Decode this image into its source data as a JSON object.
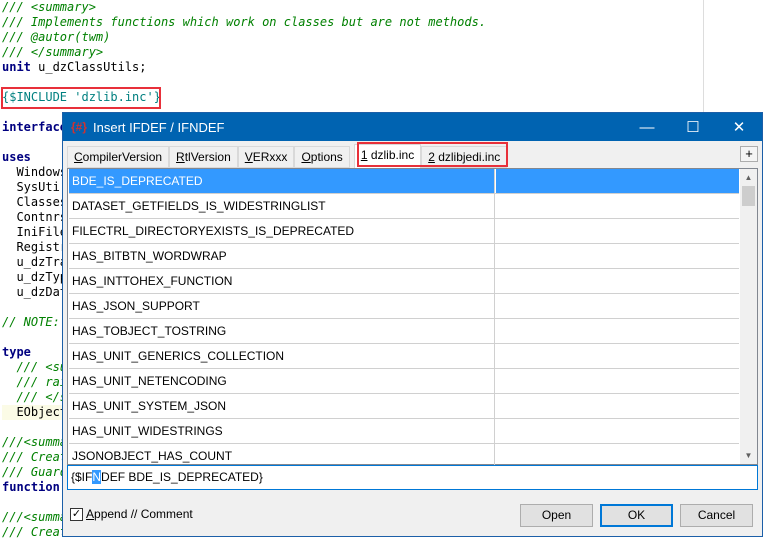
{
  "editor": {
    "lines": [
      {
        "t": "/// <summary>",
        "c": "cm"
      },
      {
        "t": "/// Implements functions which work on classes but are not methods.",
        "c": "cm"
      },
      {
        "t": "/// @autor(twm)",
        "c": "cm"
      },
      {
        "t": "/// </summary>",
        "c": "cm"
      },
      {
        "t": "unit",
        "c": "kw",
        "rest": " u_dzClassUtils;"
      },
      {
        "t": "",
        "c": "pl"
      },
      {
        "t": "{$INCLUDE 'dzlib.inc'}",
        "c": "dir"
      },
      {
        "t": "",
        "c": "pl"
      },
      {
        "t": "interface",
        "c": "kw"
      },
      {
        "t": "",
        "c": "pl"
      },
      {
        "t": "uses",
        "c": "kw"
      },
      {
        "t": "  Windows",
        "c": "pl"
      },
      {
        "t": "  SysUti",
        "c": "pl"
      },
      {
        "t": "  Classes",
        "c": "pl"
      },
      {
        "t": "  Contnrs",
        "c": "pl"
      },
      {
        "t": "  IniFile",
        "c": "pl"
      },
      {
        "t": "  Registr",
        "c": "pl"
      },
      {
        "t": "  u_dzTra",
        "c": "pl"
      },
      {
        "t": "  u_dzTyp",
        "c": "pl"
      },
      {
        "t": "  u_dzDat",
        "c": "pl"
      },
      {
        "t": "",
        "c": "pl"
      },
      {
        "t": "// NOTE:",
        "c": "cm"
      },
      {
        "t": "",
        "c": "pl"
      },
      {
        "t": "type",
        "c": "kw"
      },
      {
        "t": "  /// <su",
        "c": "cm"
      },
      {
        "t": "  /// rai",
        "c": "cm"
      },
      {
        "t": "  /// </s",
        "c": "cm"
      },
      {
        "t": "  EObject",
        "c": "pl hl"
      },
      {
        "t": "",
        "c": "pl"
      },
      {
        "t": "///<summa",
        "c": "cm"
      },
      {
        "t": "/// Creat",
        "c": "cm"
      },
      {
        "t": "/// Guard",
        "c": "cm"
      },
      {
        "t": "function",
        "c": "kw"
      },
      {
        "t": "",
        "c": "pl"
      },
      {
        "t": "///<summa",
        "c": "cm"
      },
      {
        "t": "/// Creat",
        "c": "cm"
      }
    ]
  },
  "dialog": {
    "title": "Insert IFDEF / IFNDEF",
    "tabs": [
      {
        "label": "CompilerVersion",
        "u": "C",
        "rest": "ompilerVersion"
      },
      {
        "label": "RtlVersion",
        "u": "R",
        "rest": "tlVersion"
      },
      {
        "label": "VERxxx",
        "u": "V",
        "rest": "ERxxx"
      },
      {
        "label": "Options",
        "u": "O",
        "rest": "ptions"
      },
      {
        "label": "1 dzlib.inc",
        "u": "1",
        "rest": " dzlib.inc"
      },
      {
        "label": "2 dzlibjedi.inc",
        "u": "2",
        "rest": " dzlibjedi.inc"
      }
    ],
    "active_tab": "1 dzlib.inc",
    "add_tab": "+",
    "rows": [
      "BDE_IS_DEPRECATED",
      "DATASET_GETFIELDS_IS_WIDESTRINGLIST",
      "FILECTRL_DIRECTORYEXISTS_IS_DEPRECATED",
      "HAS_BITBTN_WORDWRAP",
      "HAS_INTTOHEX_FUNCTION",
      "HAS_JSON_SUPPORT",
      "HAS_TOBJECT_TOSTRING",
      "HAS_UNIT_GENERICS_COLLECTION",
      "HAS_UNIT_NETENCODING",
      "HAS_UNIT_SYSTEM_JSON",
      "HAS_UNIT_WIDESTRINGS",
      "JSONOBJECT_HAS_COUNT"
    ],
    "selected_row": "BDE_IS_DEPRECATED",
    "input": {
      "pre": "{$IF",
      "sel": "N",
      "post": "DEF BDE_IS_DEPRECATED}"
    },
    "checkbox": {
      "label_u": "A",
      "label_rest": "ppend // Comment",
      "checked": true
    },
    "buttons": {
      "open": "Open",
      "ok": "OK",
      "cancel": "Cancel"
    },
    "accent": "#0063b1",
    "highlight": "#e8303a"
  }
}
